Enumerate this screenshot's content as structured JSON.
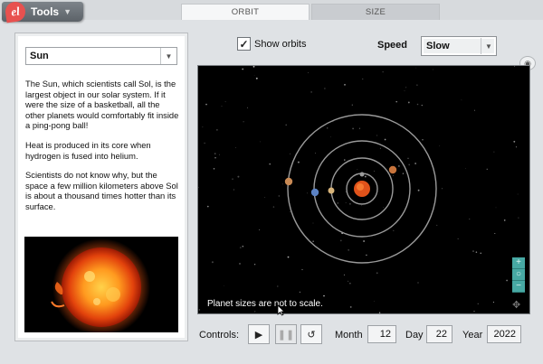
{
  "toolbar": {
    "tools_label": "Tools",
    "tabs": [
      {
        "label": "ORBIT",
        "active": true
      },
      {
        "label": "SIZE",
        "active": false
      }
    ]
  },
  "info_panel": {
    "selected_planet": "Sun",
    "paragraphs": [
      "The Sun, which scientists call Sol, is the largest object in our solar system. If it were the size of a basketball, all the other planets would comfortably fit inside a ping-pong ball!",
      "Heat is produced in its core when hydrogen is fused into helium.",
      "Scientists do not know why, but the space a few million kilometers above Sol is about a thousand times hotter than its surface."
    ]
  },
  "view_options": {
    "show_orbits_label": "Show orbits",
    "show_orbits_checked": true,
    "check_glyph": "✓",
    "speed_label": "Speed",
    "speed_value": "Slow"
  },
  "space_view": {
    "scale_note": "Planet sizes are not to scale.",
    "zoom_in": "+",
    "zoom_reset": "○",
    "zoom_out": "−",
    "move_glyph": "✥"
  },
  "controls": {
    "label": "Controls:",
    "play_glyph": "▶",
    "pause_glyph": "❚❚",
    "reset_glyph": "↺",
    "month_label": "Month",
    "month_value": "12",
    "day_label": "Day",
    "day_value": "22",
    "year_label": "Year",
    "year_value": "2022"
  },
  "colors": {
    "accent_teal": "#47a9a4",
    "sun": "#e0521a",
    "orbit_line": "#9a9a9a",
    "space_bg": "#000000"
  },
  "icons": {
    "logo": "gizmos-logo",
    "camera": "camera-icon",
    "move": "move-icon"
  }
}
